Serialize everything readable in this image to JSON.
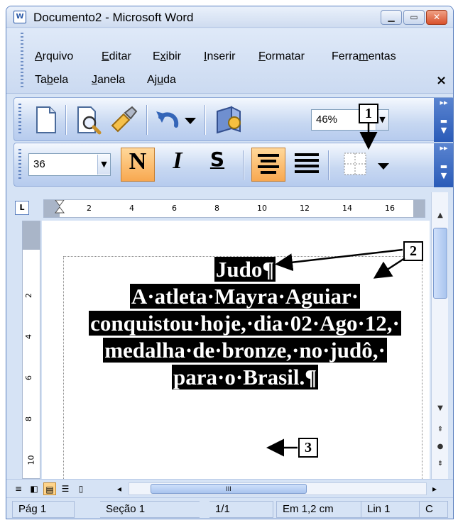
{
  "window": {
    "title": "Documento2 - Microsoft Word"
  },
  "menu": {
    "row1": [
      {
        "pre": "",
        "u": "A",
        "post": "rquivo"
      },
      {
        "pre": "",
        "u": "E",
        "post": "ditar"
      },
      {
        "pre": "E",
        "u": "x",
        "post": "ibir"
      },
      {
        "pre": "",
        "u": "I",
        "post": "nserir"
      },
      {
        "pre": "",
        "u": "F",
        "post": "ormatar"
      },
      {
        "pre": "Ferra",
        "u": "m",
        "post": "entas"
      }
    ],
    "row2": [
      {
        "pre": "Ta",
        "u": "b",
        "post": "ela"
      },
      {
        "pre": "",
        "u": "J",
        "post": "anela"
      },
      {
        "pre": "Aj",
        "u": "u",
        "post": "da"
      }
    ],
    "close_glyph": "×"
  },
  "standard_toolbar": {
    "zoom": "46%"
  },
  "formatting_toolbar": {
    "font_size": "36",
    "bold_label": "N",
    "italic_label": "I",
    "underline_label": "S"
  },
  "ruler": {
    "h_labels": [
      "2",
      "4",
      "6",
      "8",
      "10",
      "12",
      "14",
      "16"
    ],
    "v_labels": [
      "2",
      "4",
      "6",
      "8",
      "10"
    ]
  },
  "document": {
    "line1": "Judo¶",
    "line2": "A·atleta·Mayra·Aguiar·",
    "line3": "conquistou·hoje,·dia·02·Ago·12,·",
    "line4": "medalha·de·bronze,·no·judô,·",
    "line5": "para·o·Brasil.¶"
  },
  "statusbar": {
    "page": "Pág 1",
    "section": "Seção 1",
    "pages": "1/1",
    "position": "Em 1,2 cm",
    "line": "Lin 1",
    "col": "C"
  },
  "callouts": [
    "1",
    "2",
    "3"
  ],
  "hscroll_thumb": "III"
}
